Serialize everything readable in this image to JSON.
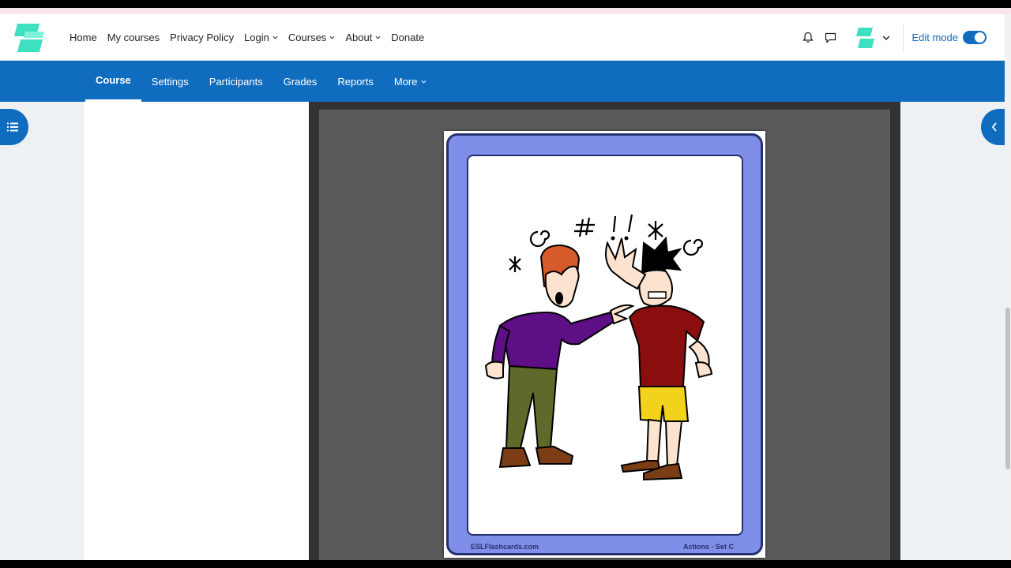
{
  "nav": {
    "logo": "site-logo",
    "links": [
      {
        "label": "Home",
        "dropdown": false
      },
      {
        "label": "My courses",
        "dropdown": false
      },
      {
        "label": "Privacy Policy",
        "dropdown": false
      },
      {
        "label": "Login",
        "dropdown": true
      },
      {
        "label": "Courses",
        "dropdown": true
      },
      {
        "label": "About",
        "dropdown": true
      },
      {
        "label": "Donate",
        "dropdown": false
      }
    ],
    "edit_mode_label": "Edit mode",
    "edit_mode_on": true
  },
  "course_nav": {
    "tabs": [
      {
        "label": "Course",
        "active": true,
        "dropdown": false
      },
      {
        "label": "Settings",
        "active": false,
        "dropdown": false
      },
      {
        "label": "Participants",
        "active": false,
        "dropdown": false
      },
      {
        "label": "Grades",
        "active": false,
        "dropdown": false
      },
      {
        "label": "Reports",
        "active": false,
        "dropdown": false
      },
      {
        "label": "More",
        "active": false,
        "dropdown": true
      }
    ]
  },
  "pdf_viewer": {
    "card_footer_left": "ESLFlashcards.com",
    "card_footer_right": "Actions - Set C"
  },
  "colors": {
    "brand": "#0f6cbf",
    "card_border": "#27306e",
    "card_frame": "#7f8ee8",
    "logo": "#3de0c0"
  }
}
